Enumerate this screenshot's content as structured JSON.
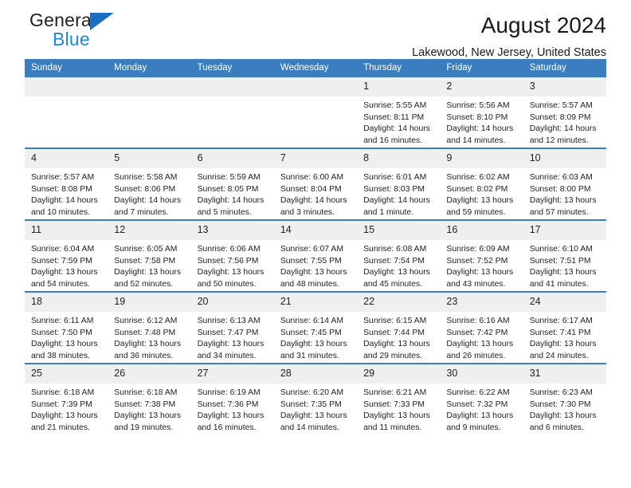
{
  "brand": {
    "name_part1": "General",
    "name_part2": "Blue",
    "triangle_color": "#1a6fc4",
    "blue_color": "#1b87dd"
  },
  "header": {
    "title": "August 2024",
    "subtitle": "Lakewood, New Jersey, United States",
    "header_bg": "#3a7ebf",
    "daynum_bg": "#efefef"
  },
  "weekdays": [
    "Sunday",
    "Monday",
    "Tuesday",
    "Wednesday",
    "Thursday",
    "Friday",
    "Saturday"
  ],
  "weeks": [
    [
      {
        "day": "",
        "lines": []
      },
      {
        "day": "",
        "lines": []
      },
      {
        "day": "",
        "lines": []
      },
      {
        "day": "",
        "lines": []
      },
      {
        "day": "1",
        "lines": [
          "Sunrise: 5:55 AM",
          "Sunset: 8:11 PM",
          "Daylight: 14 hours",
          "and 16 minutes."
        ]
      },
      {
        "day": "2",
        "lines": [
          "Sunrise: 5:56 AM",
          "Sunset: 8:10 PM",
          "Daylight: 14 hours",
          "and 14 minutes."
        ]
      },
      {
        "day": "3",
        "lines": [
          "Sunrise: 5:57 AM",
          "Sunset: 8:09 PM",
          "Daylight: 14 hours",
          "and 12 minutes."
        ]
      }
    ],
    [
      {
        "day": "4",
        "lines": [
          "Sunrise: 5:57 AM",
          "Sunset: 8:08 PM",
          "Daylight: 14 hours",
          "and 10 minutes."
        ]
      },
      {
        "day": "5",
        "lines": [
          "Sunrise: 5:58 AM",
          "Sunset: 8:06 PM",
          "Daylight: 14 hours",
          "and 7 minutes."
        ]
      },
      {
        "day": "6",
        "lines": [
          "Sunrise: 5:59 AM",
          "Sunset: 8:05 PM",
          "Daylight: 14 hours",
          "and 5 minutes."
        ]
      },
      {
        "day": "7",
        "lines": [
          "Sunrise: 6:00 AM",
          "Sunset: 8:04 PM",
          "Daylight: 14 hours",
          "and 3 minutes."
        ]
      },
      {
        "day": "8",
        "lines": [
          "Sunrise: 6:01 AM",
          "Sunset: 8:03 PM",
          "Daylight: 14 hours",
          "and 1 minute."
        ]
      },
      {
        "day": "9",
        "lines": [
          "Sunrise: 6:02 AM",
          "Sunset: 8:02 PM",
          "Daylight: 13 hours",
          "and 59 minutes."
        ]
      },
      {
        "day": "10",
        "lines": [
          "Sunrise: 6:03 AM",
          "Sunset: 8:00 PM",
          "Daylight: 13 hours",
          "and 57 minutes."
        ]
      }
    ],
    [
      {
        "day": "11",
        "lines": [
          "Sunrise: 6:04 AM",
          "Sunset: 7:59 PM",
          "Daylight: 13 hours",
          "and 54 minutes."
        ]
      },
      {
        "day": "12",
        "lines": [
          "Sunrise: 6:05 AM",
          "Sunset: 7:58 PM",
          "Daylight: 13 hours",
          "and 52 minutes."
        ]
      },
      {
        "day": "13",
        "lines": [
          "Sunrise: 6:06 AM",
          "Sunset: 7:56 PM",
          "Daylight: 13 hours",
          "and 50 minutes."
        ]
      },
      {
        "day": "14",
        "lines": [
          "Sunrise: 6:07 AM",
          "Sunset: 7:55 PM",
          "Daylight: 13 hours",
          "and 48 minutes."
        ]
      },
      {
        "day": "15",
        "lines": [
          "Sunrise: 6:08 AM",
          "Sunset: 7:54 PM",
          "Daylight: 13 hours",
          "and 45 minutes."
        ]
      },
      {
        "day": "16",
        "lines": [
          "Sunrise: 6:09 AM",
          "Sunset: 7:52 PM",
          "Daylight: 13 hours",
          "and 43 minutes."
        ]
      },
      {
        "day": "17",
        "lines": [
          "Sunrise: 6:10 AM",
          "Sunset: 7:51 PM",
          "Daylight: 13 hours",
          "and 41 minutes."
        ]
      }
    ],
    [
      {
        "day": "18",
        "lines": [
          "Sunrise: 6:11 AM",
          "Sunset: 7:50 PM",
          "Daylight: 13 hours",
          "and 38 minutes."
        ]
      },
      {
        "day": "19",
        "lines": [
          "Sunrise: 6:12 AM",
          "Sunset: 7:48 PM",
          "Daylight: 13 hours",
          "and 36 minutes."
        ]
      },
      {
        "day": "20",
        "lines": [
          "Sunrise: 6:13 AM",
          "Sunset: 7:47 PM",
          "Daylight: 13 hours",
          "and 34 minutes."
        ]
      },
      {
        "day": "21",
        "lines": [
          "Sunrise: 6:14 AM",
          "Sunset: 7:45 PM",
          "Daylight: 13 hours",
          "and 31 minutes."
        ]
      },
      {
        "day": "22",
        "lines": [
          "Sunrise: 6:15 AM",
          "Sunset: 7:44 PM",
          "Daylight: 13 hours",
          "and 29 minutes."
        ]
      },
      {
        "day": "23",
        "lines": [
          "Sunrise: 6:16 AM",
          "Sunset: 7:42 PM",
          "Daylight: 13 hours",
          "and 26 minutes."
        ]
      },
      {
        "day": "24",
        "lines": [
          "Sunrise: 6:17 AM",
          "Sunset: 7:41 PM",
          "Daylight: 13 hours",
          "and 24 minutes."
        ]
      }
    ],
    [
      {
        "day": "25",
        "lines": [
          "Sunrise: 6:18 AM",
          "Sunset: 7:39 PM",
          "Daylight: 13 hours",
          "and 21 minutes."
        ]
      },
      {
        "day": "26",
        "lines": [
          "Sunrise: 6:18 AM",
          "Sunset: 7:38 PM",
          "Daylight: 13 hours",
          "and 19 minutes."
        ]
      },
      {
        "day": "27",
        "lines": [
          "Sunrise: 6:19 AM",
          "Sunset: 7:36 PM",
          "Daylight: 13 hours",
          "and 16 minutes."
        ]
      },
      {
        "day": "28",
        "lines": [
          "Sunrise: 6:20 AM",
          "Sunset: 7:35 PM",
          "Daylight: 13 hours",
          "and 14 minutes."
        ]
      },
      {
        "day": "29",
        "lines": [
          "Sunrise: 6:21 AM",
          "Sunset: 7:33 PM",
          "Daylight: 13 hours",
          "and 11 minutes."
        ]
      },
      {
        "day": "30",
        "lines": [
          "Sunrise: 6:22 AM",
          "Sunset: 7:32 PM",
          "Daylight: 13 hours",
          "and 9 minutes."
        ]
      },
      {
        "day": "31",
        "lines": [
          "Sunrise: 6:23 AM",
          "Sunset: 7:30 PM",
          "Daylight: 13 hours",
          "and 6 minutes."
        ]
      }
    ]
  ]
}
